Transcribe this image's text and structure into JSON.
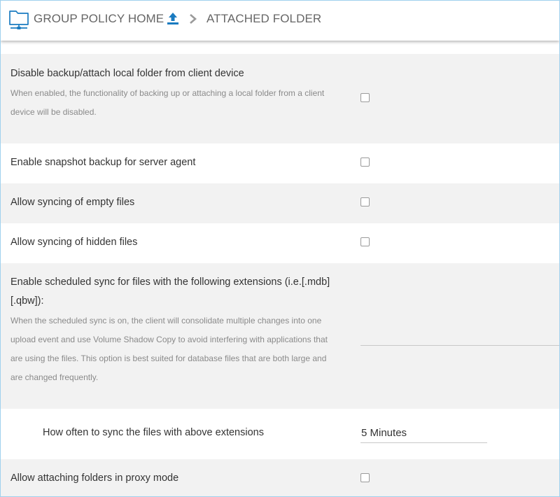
{
  "header": {
    "home_label": "GROUP POLICY HOME",
    "current_label": "ATTACHED FOLDER",
    "accent_color": "#1a7bc0"
  },
  "settings": {
    "disable_backup": {
      "title": "Disable backup/attach local folder from client device",
      "desc_line1": "When enabled, the functionality of backing up or attaching a local folder from a client",
      "desc_line2": "device will be disabled.",
      "checked": false
    },
    "snapshot_backup": {
      "title": "Enable snapshot backup for server agent",
      "checked": false
    },
    "sync_empty": {
      "title": "Allow syncing of empty files",
      "checked": false
    },
    "sync_hidden": {
      "title": "Allow syncing of hidden files",
      "checked": false
    },
    "scheduled_sync": {
      "title_line1": "Enable scheduled sync for files with the following extensions (i.e.[.mdb]",
      "title_line2": "[.qbw]):",
      "desc_line1": "When the scheduled sync is on, the client will consolidate multiple changes into one",
      "desc_line2": "upload event and use Volume Shadow Copy to avoid interfering with applications that",
      "desc_line3": "are using the files. This option is best suited for database files that are both large and",
      "desc_line4": "are changed frequently.",
      "value": ""
    },
    "sync_frequency": {
      "title": "How often to sync the files with above extensions",
      "value": "5 Minutes"
    },
    "proxy_mode": {
      "title": "Allow attaching folders in proxy mode",
      "checked": false
    }
  }
}
